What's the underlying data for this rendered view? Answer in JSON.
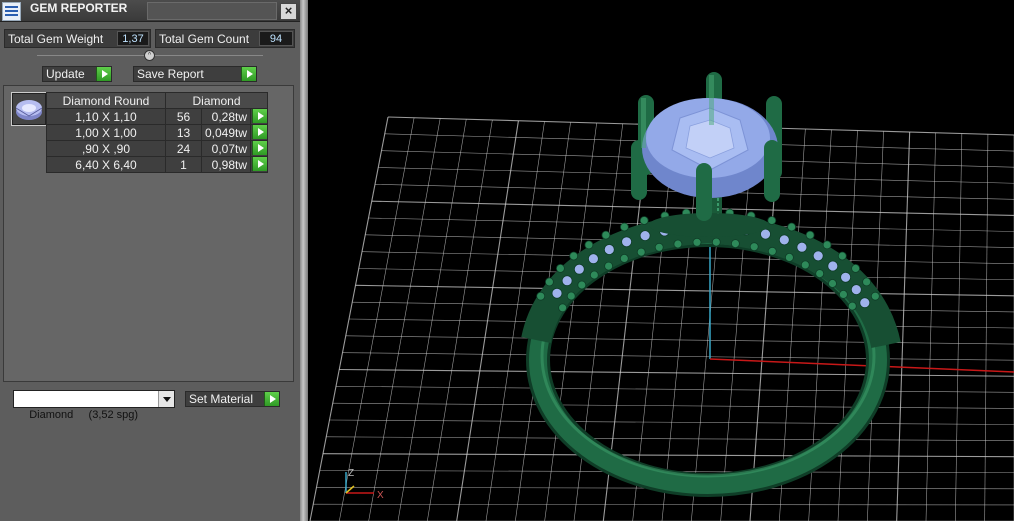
{
  "window": {
    "title": "GEM REPORTER",
    "close_label": "×"
  },
  "stats": {
    "weight_label": "Total Gem Weight",
    "weight_value": "1,37",
    "count_label": "Total Gem Count",
    "count_value": "94"
  },
  "buttons": {
    "update": "Update",
    "save_report": "Save Report",
    "set_material": "Set Material"
  },
  "table": {
    "col_shape": "Diamond Round",
    "col_material": "Diamond",
    "rows": [
      {
        "size": "1,10 X 1,10",
        "count": "56",
        "weight": "0,28tw"
      },
      {
        "size": "1,00 X 1,00",
        "count": "13",
        "weight": "0,049tw"
      },
      {
        "size": ",90 X ,90",
        "count": "24",
        "weight": "0,07tw"
      },
      {
        "size": "6,40 X 6,40",
        "count": "1",
        "weight": "0,98tw"
      }
    ]
  },
  "material_select": {
    "value": "Diamond     (3,52 spg)"
  },
  "viewport": {
    "axis_z": "Z",
    "axis_x": "X",
    "colors": {
      "metal": "#1f6b45",
      "gem": "#8fa6e6",
      "grid": "#cfcfcf",
      "axis_x": "#c81818",
      "axis_y": "#39a7c7"
    }
  }
}
